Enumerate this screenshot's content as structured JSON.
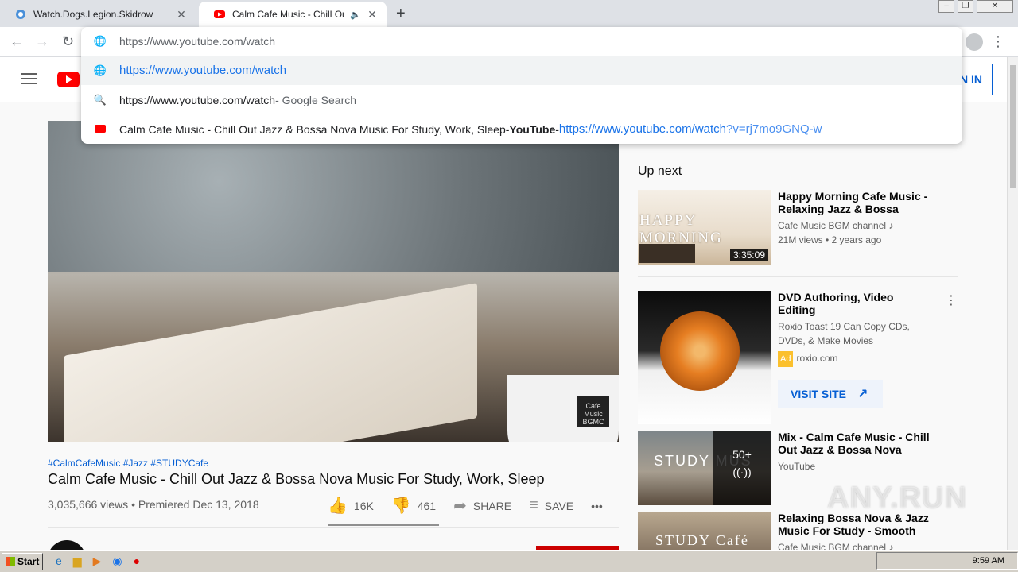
{
  "browser": {
    "tabs": [
      {
        "title": "Watch.Dogs.Legion.Skidrow",
        "active": false,
        "favicon": "blue-dot-icon"
      },
      {
        "title": "Calm Cafe Music - Chill Out Jazz",
        "active": true,
        "favicon": "youtube-icon",
        "audio": "speaker-icon"
      }
    ],
    "new_tab": "+",
    "window_controls": {
      "minimize": "–",
      "restore": "❐",
      "close": "✕"
    },
    "nav": {
      "back": "←",
      "forward": "→",
      "reload": "↻"
    },
    "menu": "⋮"
  },
  "omnibox": {
    "input_text": "https://www.youtube.com/watch",
    "suggestions": [
      {
        "type": "url",
        "text": "https://www.youtube.com/watch"
      },
      {
        "type": "search",
        "text": "https://www.youtube.com/watch",
        "suffix": " - Google Search"
      },
      {
        "type": "history",
        "text": "Calm Cafe Music - Chill Out Jazz & Bossa Nova Music For Study, Work, Sleep",
        "separator": " - ",
        "site": "YouTube",
        "url_main": "https://www.youtube.com/watch",
        "url_tail": "?v=rj7mo9GNQ-w"
      }
    ]
  },
  "youtube": {
    "sign_in": "IN IN",
    "video": {
      "hashtags": "#CalmCafeMusic #Jazz #STUDYCafe",
      "title": "Calm Cafe Music - Chill Out Jazz & Bossa Nova Music For Study, Work, Sleep",
      "meta": "3,035,666 views • Premiered Dec 13, 2018",
      "likes": "16K",
      "dislikes": "461",
      "share": "SHARE",
      "save": "SAVE",
      "more": "•••",
      "watermark": "Cafe Music BGMC"
    },
    "up_next_label": "Up next",
    "recommendations": [
      {
        "title": "Happy Morning Cafe Music - Relaxing Jazz & Bossa Nova...",
        "channel": "Cafe Music BGM channel ♪",
        "stats": "21M views • 2 years ago",
        "duration": "3:35:09",
        "thumb_text": "HAPPY MORNING"
      },
      {
        "title": "DVD Authoring, Video Editing",
        "channel": "Roxio Toast 19 Can Copy CDs, DVDs, & Make Movies",
        "ad_badge": "Ad",
        "ad_domain": "roxio.com",
        "visit": "VISIT SITE"
      },
      {
        "title": "Mix - Calm Cafe Music - Chill Out Jazz & Bossa Nova Music...",
        "channel": "YouTube",
        "mix_count": "50+",
        "thumb_text": "STUDY MUS"
      },
      {
        "title": "Relaxing Bossa Nova & Jazz Music For Study - Smooth Jaz...",
        "channel": "Cafe Music BGM channel ♪",
        "thumb_text": "STUDY Café"
      }
    ],
    "site_watermark": "ANY.RUN"
  },
  "taskbar": {
    "start": "Start",
    "clock": "9:59 AM"
  }
}
